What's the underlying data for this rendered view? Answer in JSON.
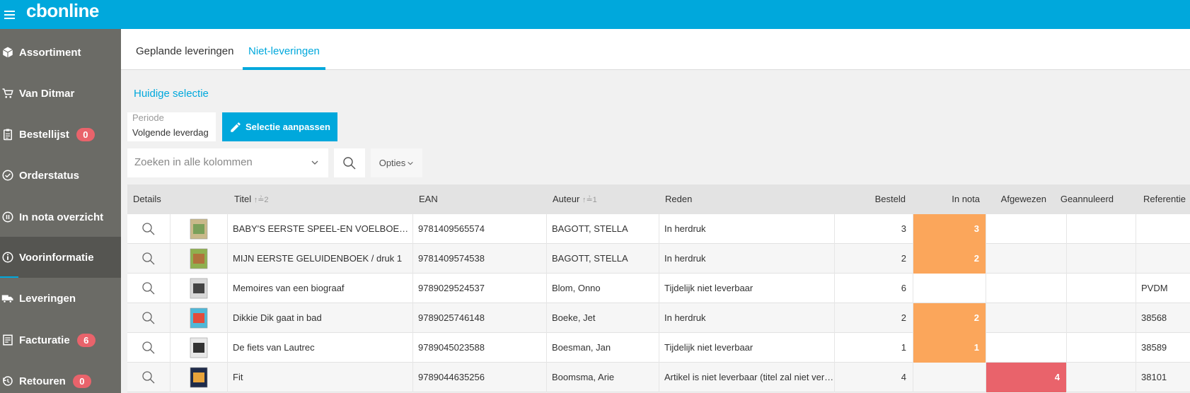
{
  "app": {
    "logo_cb": "cb",
    "logo_online": "online"
  },
  "sidebar": {
    "items": [
      {
        "label": "Assortiment",
        "icon": "package-icon"
      },
      {
        "label": "Van Ditmar",
        "icon": "cart-icon"
      },
      {
        "label": "Bestellijst",
        "icon": "clipboard-icon",
        "badge": "0"
      },
      {
        "label": "Orderstatus",
        "icon": "check-circle-icon"
      },
      {
        "label": "In nota overzicht",
        "icon": "pause-circle-icon"
      },
      {
        "label": "Voorinformatie",
        "icon": "info-circle-icon",
        "active": true
      },
      {
        "label": "Leveringen",
        "icon": "truck-icon"
      },
      {
        "label": "Facturatie",
        "icon": "invoice-icon",
        "badge": "6"
      },
      {
        "label": "Retouren",
        "icon": "return-icon",
        "badge": "0"
      }
    ]
  },
  "tabs": [
    {
      "label": "Geplande leveringen",
      "active": false
    },
    {
      "label": "Niet-leveringen",
      "active": true
    }
  ],
  "selection": {
    "title": "Huidige selectie",
    "periode_label": "Periode",
    "periode_value": "Volgende leverdag",
    "edit_button": "Selectie aanpassen"
  },
  "search": {
    "placeholder": "Zoeken in alle kolommen",
    "options_label": "Opties"
  },
  "table": {
    "headers": {
      "details": "Details",
      "titel": "Titel",
      "titel_sort": "↑≟2",
      "ean": "EAN",
      "auteur": "Auteur",
      "auteur_sort": "↑≟1",
      "reden": "Reden",
      "besteld": "Besteld",
      "in_nota": "In nota",
      "afgewezen": "Afgewezen",
      "geannuleerd": "Geannuleerd",
      "referentie": "Referentie"
    },
    "rows": [
      {
        "titel": "BABY'S EERSTE SPEEL-EN VOELBOEK - ...",
        "ean": "9781409565574",
        "auteur": "BAGOTT, STELLA",
        "reden": "In herdruk",
        "besteld": "3",
        "in_nota": "3",
        "afgewezen": "",
        "geannuleerd": "",
        "referentie": "",
        "thumb_colors": [
          "#c9b98a",
          "#7aa05a"
        ]
      },
      {
        "titel": "MIJN EERSTE GELUIDENBOEK / druk 1",
        "ean": "9781409574538",
        "auteur": "BAGOTT, STELLA",
        "reden": "In herdruk",
        "besteld": "2",
        "in_nota": "2",
        "afgewezen": "",
        "geannuleerd": "",
        "referentie": "",
        "thumb_colors": [
          "#8fb04f",
          "#b0723c"
        ]
      },
      {
        "titel": "Memoires van een biograaf",
        "ean": "9789029524537",
        "auteur": "Blom, Onno",
        "reden": "Tijdelijk niet leverbaar",
        "besteld": "6",
        "in_nota": "",
        "afgewezen": "",
        "geannuleerd": "",
        "referentie": "PVDM",
        "thumb_colors": [
          "#d8d8d8",
          "#444444"
        ]
      },
      {
        "titel": "Dikkie Dik gaat in bad",
        "ean": "9789025746148",
        "auteur": "Boeke, Jet",
        "reden": "In herdruk",
        "besteld": "2",
        "in_nota": "2",
        "afgewezen": "",
        "geannuleerd": "",
        "referentie": "38568",
        "thumb_colors": [
          "#4fb8d8",
          "#e34b3b"
        ]
      },
      {
        "titel": "De fiets van Lautrec",
        "ean": "9789045023588",
        "auteur": "Boesman, Jan",
        "reden": "Tijdelijk niet leverbaar",
        "besteld": "1",
        "in_nota": "1",
        "afgewezen": "",
        "geannuleerd": "",
        "referentie": "38589",
        "thumb_colors": [
          "#e8e8e8",
          "#333333"
        ]
      },
      {
        "titel": "Fit",
        "ean": "9789044635256",
        "auteur": "Boomsma, Arie",
        "reden": "Artikel is niet leverbaar (titel zal niet vers...",
        "besteld": "4",
        "in_nota": "",
        "afgewezen": "4",
        "geannuleerd": "",
        "referentie": "38101",
        "thumb_colors": [
          "#1f2b4a",
          "#e8a33a"
        ]
      }
    ]
  },
  "colors": {
    "accent": "#00a8dc",
    "sidebar": "#6b6b66",
    "badge": "#e9636b",
    "in_nota": "#fba65b",
    "afgewezen": "#e9636b"
  }
}
